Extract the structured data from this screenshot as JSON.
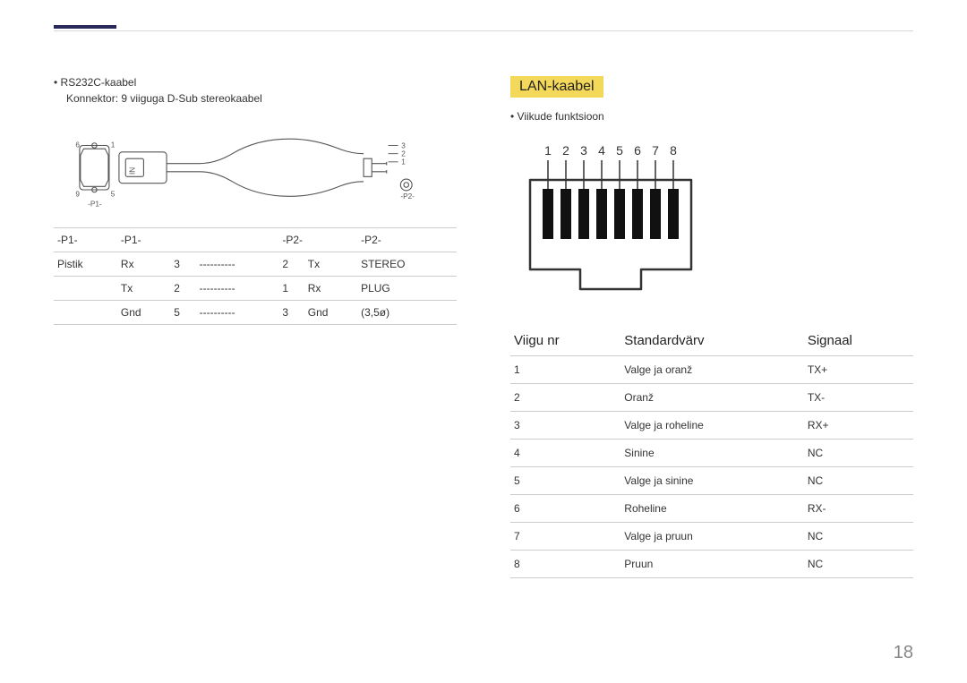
{
  "left": {
    "bullet": "RS232C-kaabel",
    "subline": "Konnektor: 9 viiguga D-Sub stereokaabel",
    "diagram": {
      "pin6": "6",
      "pin1": "1",
      "pin9": "9",
      "pin5": "5",
      "t3": "3",
      "t2": "2",
      "t1": "1",
      "p1": "-P1-",
      "p2": "-P2-",
      "in": "IN"
    },
    "table": {
      "head": [
        "-P1-",
        "-P1-",
        "",
        "-P2-",
        "",
        "-P2-"
      ],
      "rows": [
        [
          "Pistik",
          "Rx",
          "3",
          "----------",
          "2",
          "Tx",
          "STEREO"
        ],
        [
          "",
          "Tx",
          "2",
          "----------",
          "1",
          "Rx",
          "PLUG"
        ],
        [
          "",
          "Gnd",
          "5",
          "----------",
          "3",
          "Gnd",
          "(3,5ø)"
        ]
      ]
    }
  },
  "right": {
    "section_title": "LAN-kaabel",
    "bullet": "Viikude funktsioon",
    "pins": [
      "1",
      "2",
      "3",
      "4",
      "5",
      "6",
      "7",
      "8"
    ],
    "table": {
      "head": [
        "Viigu nr",
        "Standardvärv",
        "Signaal"
      ],
      "rows": [
        [
          "1",
          "Valge ja oranž",
          "TX+"
        ],
        [
          "2",
          "Oranž",
          "TX-"
        ],
        [
          "3",
          "Valge ja roheline",
          "RX+"
        ],
        [
          "4",
          "Sinine",
          "NC"
        ],
        [
          "5",
          "Valge ja sinine",
          "NC"
        ],
        [
          "6",
          "Roheline",
          "RX-"
        ],
        [
          "7",
          "Valge ja pruun",
          "NC"
        ],
        [
          "8",
          "Pruun",
          "NC"
        ]
      ]
    }
  },
  "page_number": "18"
}
